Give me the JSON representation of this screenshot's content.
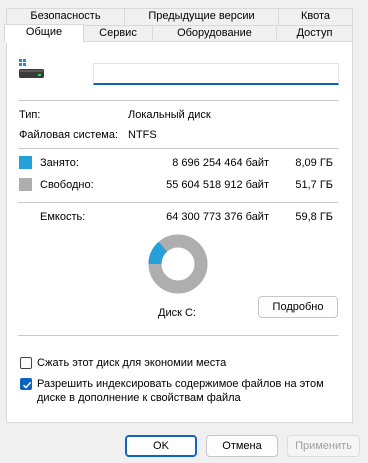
{
  "tabs_row1": [
    {
      "label": "Безопасность"
    },
    {
      "label": "Предыдущие версии"
    },
    {
      "label": "Квота"
    }
  ],
  "tabs_row2": [
    {
      "label": "Общие",
      "active": true
    },
    {
      "label": "Сервис"
    },
    {
      "label": "Оборудование"
    },
    {
      "label": "Доступ"
    }
  ],
  "drive": {
    "icon": "drive-icon",
    "name_value": "",
    "type_label": "Тип:",
    "type_value": "Локальный диск",
    "fs_label": "Файловая система:",
    "fs_value": "NTFS"
  },
  "usage": {
    "used_label": "Занято:",
    "used_bytes": "8 696 254 464 байт",
    "used_size": "8,09 ГБ",
    "free_label": "Свободно:",
    "free_bytes": "55 604 518 912 байт",
    "free_size": "51,7 ГБ",
    "capacity_label": "Емкость:",
    "capacity_bytes": "64 300 773 376 байт",
    "capacity_size": "59,8 ГБ",
    "used_fraction": 0.135
  },
  "colors": {
    "used": "#26a0da",
    "free": "#aeaeae",
    "accent": "#0a64c0"
  },
  "disk_label": "Диск С:",
  "details_button": "Подробно",
  "options": {
    "compress_label": "Сжать этот диск для экономии места",
    "compress_checked": false,
    "index_label_line1": "Разрешить индексировать содержимое файлов на этом",
    "index_label_line2": "диске в дополнение к свойствам файла",
    "index_checked": true
  },
  "buttons": {
    "ok": "OK",
    "cancel": "Отмена",
    "apply": "Применить"
  }
}
